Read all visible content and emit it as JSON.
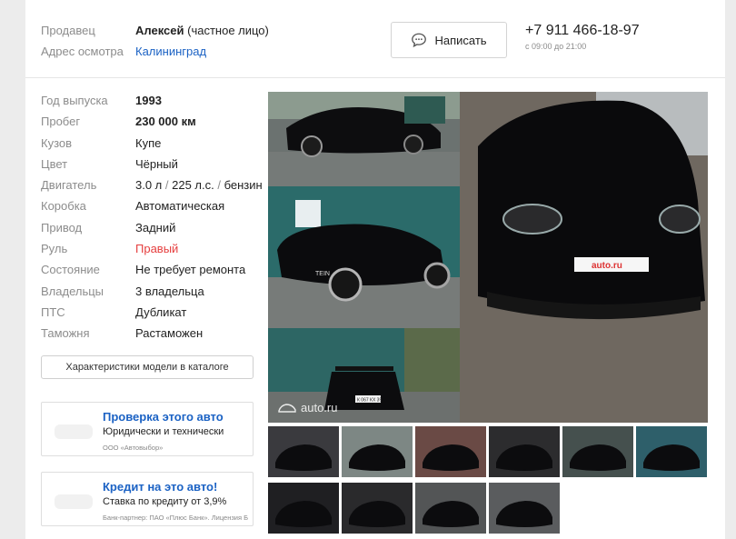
{
  "seller": {
    "seller_label": "Продавец",
    "seller_name": "Алексей",
    "seller_type": "(частное лицо)",
    "address_label": "Адрес осмотра",
    "address_value": "Калининград",
    "write_button": "Написать",
    "phone": "+7 911 466-18-97",
    "hours": "с 09:00 до 21:00"
  },
  "specs": [
    {
      "key": "Год выпуска",
      "value": "1993",
      "style": "bold"
    },
    {
      "key": "Пробег",
      "value": "230 000 км",
      "style": "bold"
    },
    {
      "key": "Кузов",
      "value": "Купе",
      "style": ""
    },
    {
      "key": "Цвет",
      "value": "Чёрный",
      "style": ""
    },
    {
      "key": "Двигатель",
      "value": "3.0 л / 225 л.с. / бензин",
      "style": "engine"
    },
    {
      "key": "Коробка",
      "value": "Автоматическая",
      "style": ""
    },
    {
      "key": "Привод",
      "value": "Задний",
      "style": ""
    },
    {
      "key": "Руль",
      "value": "Правый",
      "style": "red"
    },
    {
      "key": "Состояние",
      "value": "Не требует ремонта",
      "style": ""
    },
    {
      "key": "Владельцы",
      "value": "3 владельца",
      "style": ""
    },
    {
      "key": "ПТС",
      "value": "Дубликат",
      "style": ""
    },
    {
      "key": "Таможня",
      "value": "Растаможен",
      "style": ""
    }
  ],
  "engine_parts": [
    "3.0 л",
    "225 л.с.",
    "бензин"
  ],
  "catalog_button": "Характеристики модели в каталоге",
  "promos": [
    {
      "title": "Проверка этого авто",
      "subtitle": "Юридически и технически",
      "note": "ООО «Автовыбор»"
    },
    {
      "title": "Кредит на это авто!",
      "subtitle": "Ставка по кредиту от 3,9%",
      "note": "Банк-партнер: ПАО «Плюс Банк». Лицензия Б"
    }
  ],
  "gallery": {
    "watermark": "auto.ru",
    "plate_text": "auto.ru",
    "rear_plate": "К 067 КХ 39"
  },
  "colors": {
    "link": "#1b62c4",
    "red": "#e53e3e",
    "muted": "#8c8c8c"
  }
}
